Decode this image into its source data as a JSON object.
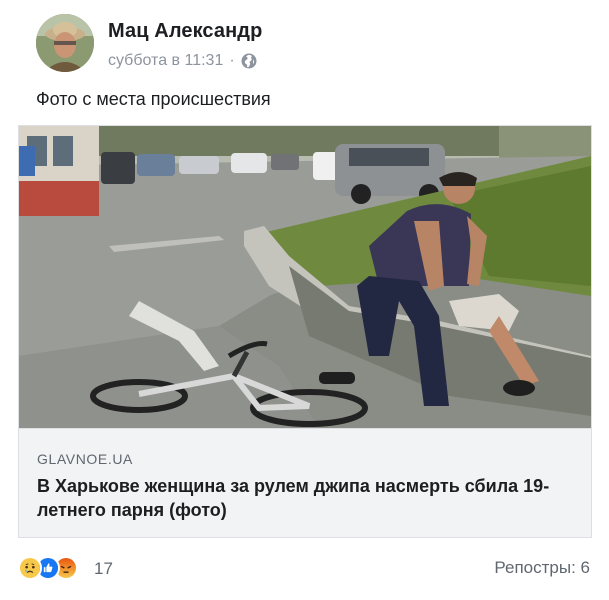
{
  "post": {
    "author": "Мац Александр",
    "timestamp": "суббота в 11:31",
    "separator": "·",
    "privacy_icon": "globe-icon",
    "text": "Фото с места происшествия"
  },
  "link_preview": {
    "domain": "GLAVNOE.UA",
    "title": "В Харькове женщина за рулем джипа насмерть сбила 19-летнего парня (фото)"
  },
  "footer": {
    "reactions": [
      "sad",
      "like",
      "angry"
    ],
    "reaction_count": "17",
    "shares_label": "Репостры: 6"
  },
  "colors": {
    "like_blue": "#1877f2",
    "sad_yellow": "#f7c94b",
    "angry_red": "#e9710f",
    "meta_gray": "#8d949e",
    "card_bg": "#f2f3f5"
  }
}
